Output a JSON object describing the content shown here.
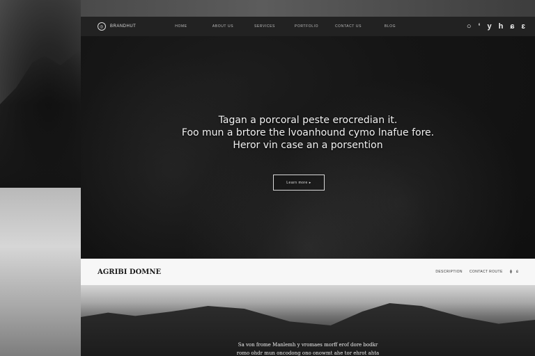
{
  "brand": {
    "name": "BRANDHUT",
    "mark": "◎"
  },
  "nav": {
    "links": [
      "HOME",
      "ABOUT US",
      "SERVICES",
      "PORTFOLIO",
      "CONTACT US",
      "BLOG"
    ],
    "icons": [
      "○",
      "ʻ",
      "y",
      "h",
      "ɕ",
      "ɛ"
    ]
  },
  "hero": {
    "line1": "Tagan a porcoral peste erocredian it.",
    "line2": "Foo mun a brtore the lvoanhound cymo lnafue fore.",
    "line3": "Heror vin case an a porsention",
    "cta": "Learn more ▸"
  },
  "section": {
    "title": "AGRIBI DOMNE",
    "links": [
      "DESCRIPTION",
      "CONTACT ROUTE"
    ],
    "icons": [
      "ɸ",
      "ɕ"
    ]
  },
  "mountain": {
    "line1": "Sa von frome Manlemh y vromaes morff erof dore bodkr",
    "line2": "romo ohdr mun oncodong ono onowmt ahe tor ehrot ahta"
  },
  "colors": {
    "nav_bg": "#222222",
    "hero_bg": "#121212",
    "section_bg": "#f7f7f7"
  }
}
